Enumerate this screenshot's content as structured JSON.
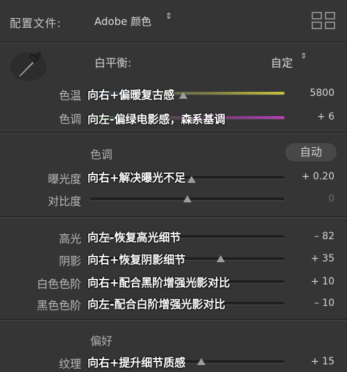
{
  "header": {
    "profile_label": "配置文件:",
    "profile_value": "Adobe 颜色",
    "profile_arrows": "⇕"
  },
  "white_balance": {
    "label": "白平衡:",
    "value": "自定",
    "arrows": "⇕"
  },
  "sliders": {
    "temp": {
      "label": "色温",
      "annot": "向右+偏暖复古感",
      "value": "5800",
      "pos": 0.48
    },
    "tint": {
      "label": "色调",
      "annot": "向左-偏绿电影感，森系基调",
      "value": "+ 6",
      "pos": 0.52
    },
    "exposure": {
      "label": "曝光度",
      "annot": "向右+解决曝光不足",
      "value": "+ 0.20",
      "pos": 0.52
    },
    "contrast": {
      "label": "对比度",
      "annot": "",
      "value": "0",
      "pos": 0.5
    },
    "highlights": {
      "label": "高光",
      "annot": "向左-恢复高光细节",
      "value": "– 82",
      "pos": 0.09
    },
    "shadows": {
      "label": "阴影",
      "annot": "向右+恢复阴影细节",
      "value": "+ 35",
      "pos": 0.67
    },
    "whites": {
      "label": "白色色阶",
      "annot": "向右+配合黑阶增强光影对比",
      "value": "+ 10",
      "pos": 0.55
    },
    "blacks": {
      "label": "黑色色阶",
      "annot": "向左-配合白阶增强光影对比",
      "value": "– 10",
      "pos": 0.45
    },
    "texture": {
      "label": "纹理",
      "annot": "向右+提升细节质感",
      "value": "+ 15",
      "pos": 0.57
    }
  },
  "tone": {
    "section_title": "色调",
    "auto_label": "自动"
  },
  "presence": {
    "section_title": "偏好"
  }
}
